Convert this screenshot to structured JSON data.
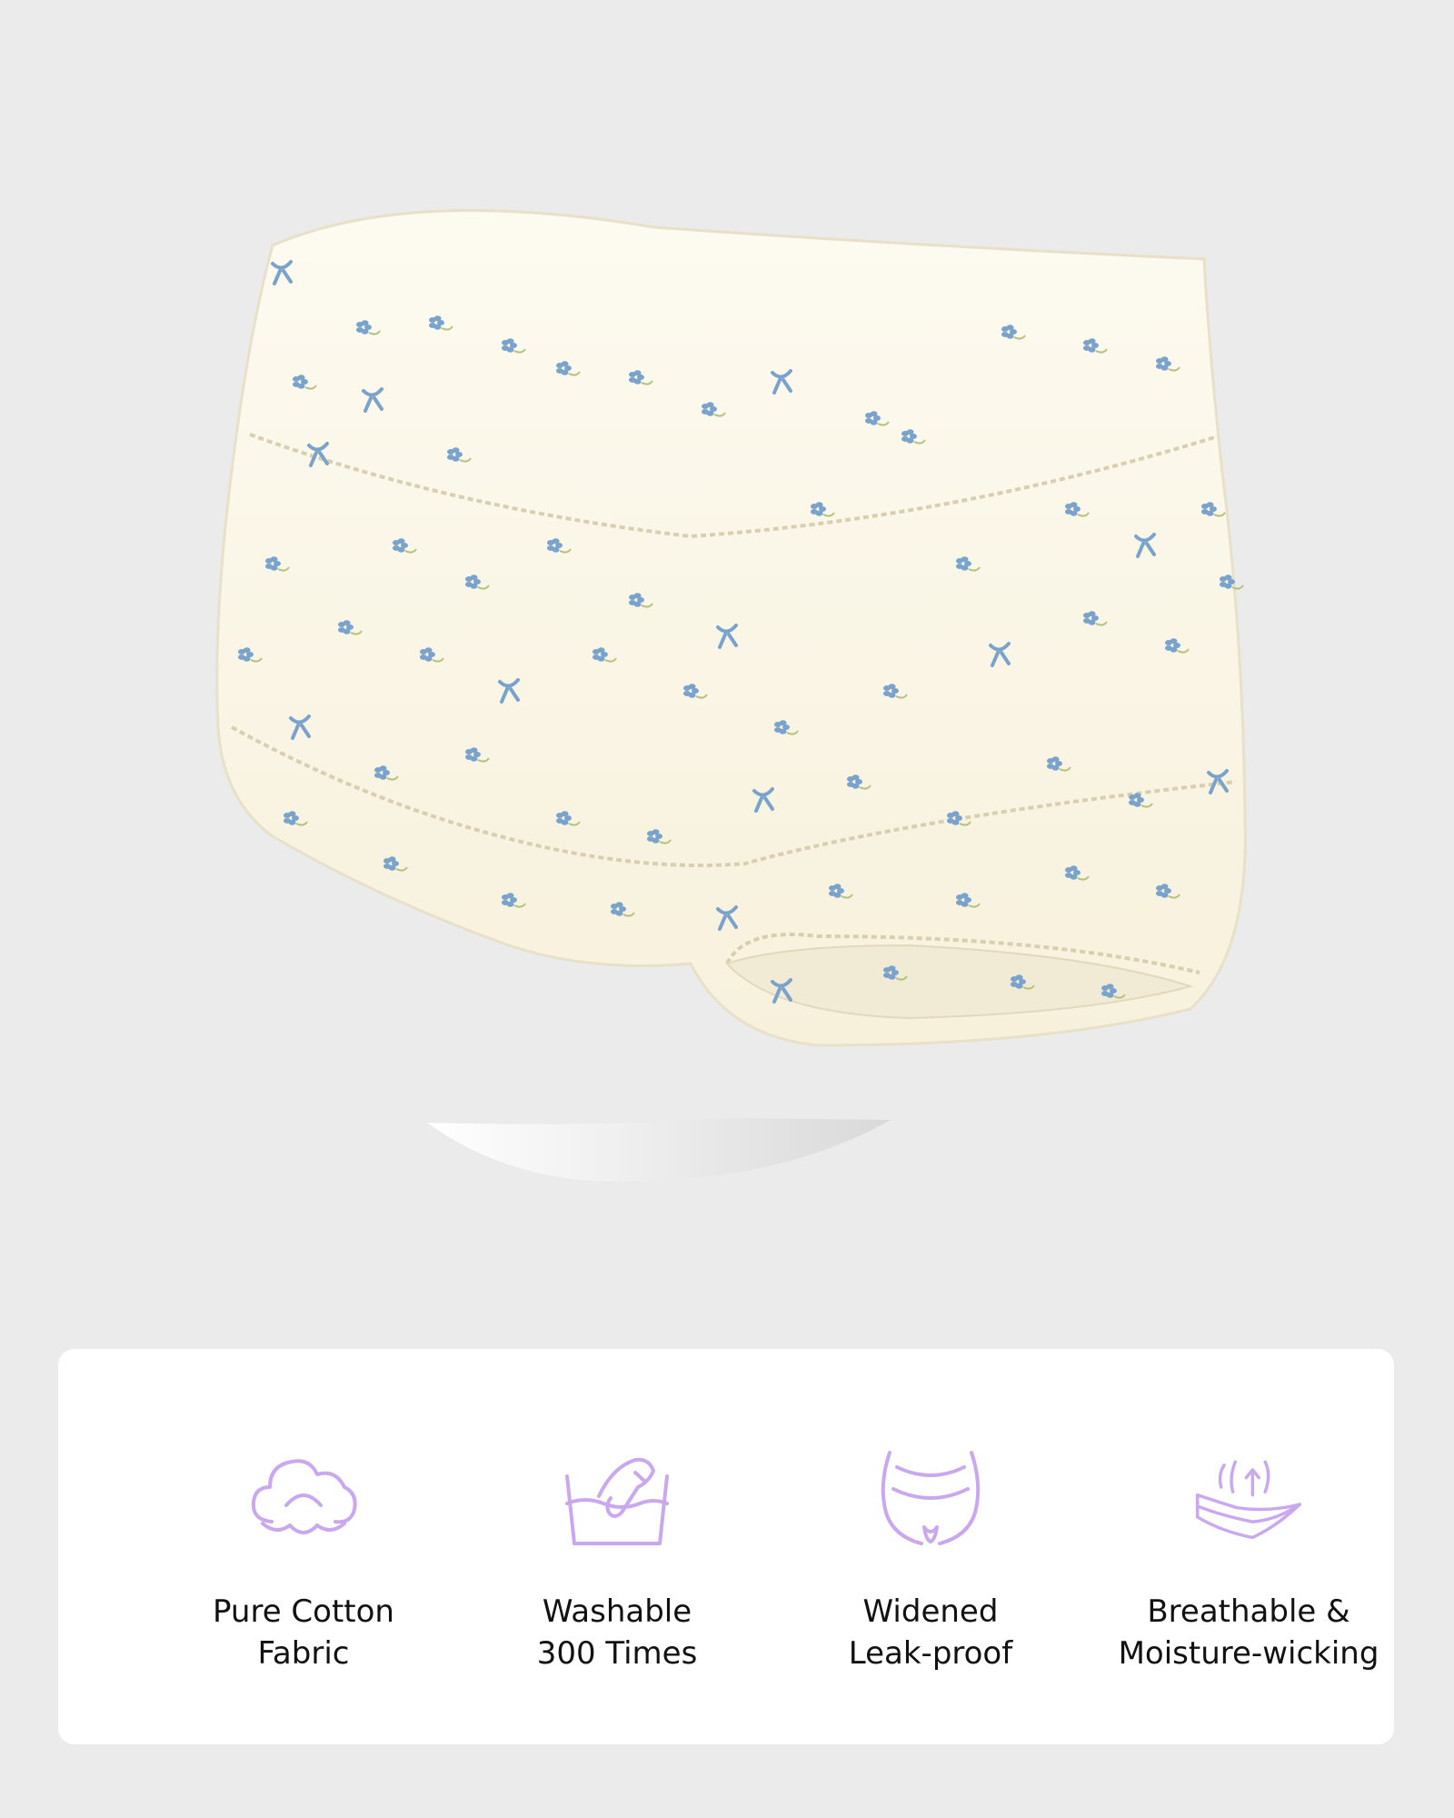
{
  "colors": {
    "background": "#ebebeb",
    "card": "#ffffff",
    "icon_accent": "#c9a8ef",
    "text": "#111111",
    "fabric": "#fbf7e8",
    "print": "#7aa3cc"
  },
  "product_image": {
    "icon": "floral-print-underwear-image"
  },
  "features": [
    {
      "icon": "cotton-icon",
      "line1": "Pure Cotton",
      "line2": "Fabric"
    },
    {
      "icon": "hand-wash-icon",
      "line1": "Washable",
      "line2": "300 Times"
    },
    {
      "icon": "body-outline-icon",
      "line1": "Widened",
      "line2": "Leak-proof"
    },
    {
      "icon": "breathable-layers-icon",
      "line1": "Breathable &",
      "line2": "Moisture-wicking"
    }
  ]
}
